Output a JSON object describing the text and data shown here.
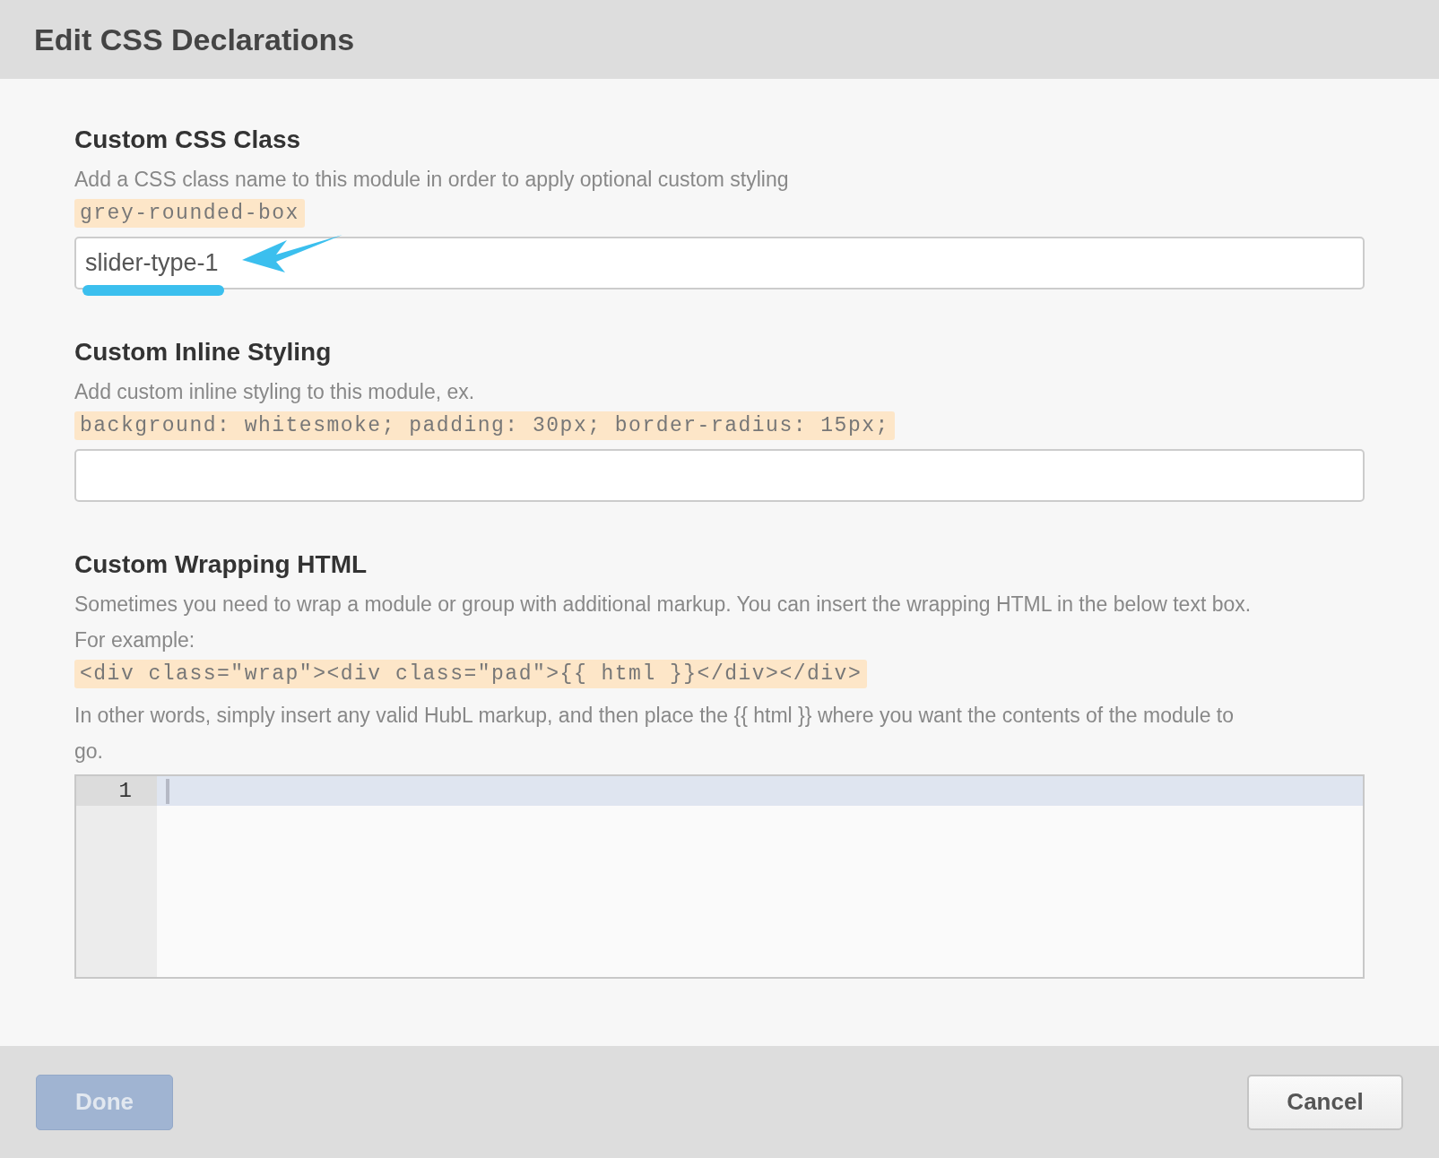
{
  "dialog": {
    "title": "Edit CSS Declarations"
  },
  "sections": [
    {
      "heading": "Custom CSS Class",
      "description": "Add a CSS class name to this module in order to apply optional custom styling",
      "example": "grey-rounded-box",
      "field": {
        "kind": "text",
        "value": "slider-type-1",
        "annotated": true
      }
    },
    {
      "heading": "Custom Inline Styling",
      "description": "Add custom inline styling to this module, ex.",
      "example": "background: whitesmoke; padding: 30px; border-radius: 15px;",
      "field": {
        "kind": "text",
        "annotated": false
      }
    },
    {
      "heading": "Custom Wrapping HTML",
      "description": "Sometimes you need to wrap a module or group with additional markup. You can insert the wrapping HTML in the below text box. For example:",
      "example": "<div class=\"wrap\"><div class=\"pad\">{{ html }}</div></div>",
      "note": "In other words, simply insert any valid HubL markup, and then place the {{ html }} where you want the contents of the module to go.",
      "field": {
        "kind": "code",
        "lines": [
          {
            "number": "1",
            "active": true
          }
        ]
      }
    }
  ],
  "buttons": [
    {
      "label": "Done",
      "kind": "primary",
      "disabled": true
    },
    {
      "label": "Cancel",
      "kind": "secondary",
      "disabled": false
    }
  ]
}
